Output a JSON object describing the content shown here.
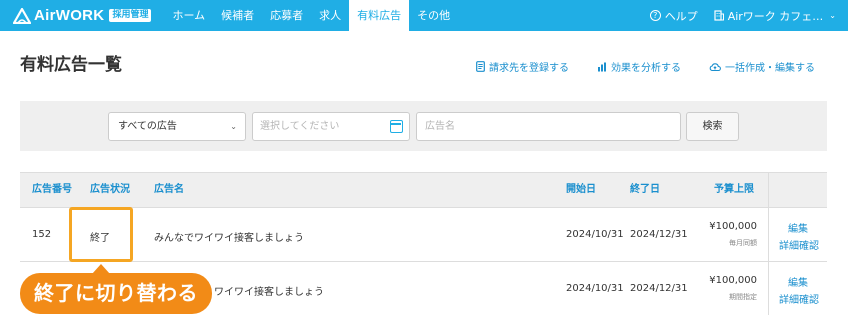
{
  "header": {
    "logo_text": "AirWORK",
    "logo_badge": "採用管理",
    "nav": [
      {
        "label": "ホーム",
        "active": false
      },
      {
        "label": "候補者",
        "active": false
      },
      {
        "label": "応募者",
        "active": false
      },
      {
        "label": "求人",
        "active": false
      },
      {
        "label": "有料広告",
        "active": true
      },
      {
        "label": "その他",
        "active": false
      }
    ],
    "help_label": "ヘルプ",
    "account_label": "Airワーク カフェ…"
  },
  "page": {
    "title": "有料広告一覧",
    "actions": [
      {
        "label": "請求先を登録する",
        "icon": "document-icon"
      },
      {
        "label": "効果を分析する",
        "icon": "bar-chart-icon"
      },
      {
        "label": "一括作成・編集する",
        "icon": "cloud-upload-icon"
      }
    ]
  },
  "search": {
    "type_select": "すべての広告",
    "date_placeholder": "選択してください",
    "name_placeholder": "広告名",
    "button_label": "検索"
  },
  "table": {
    "headers": {
      "number": "広告番号",
      "status": "広告状況",
      "name": "広告名",
      "start": "開始日",
      "end": "終了日",
      "budget": "予算上限"
    },
    "rows": [
      {
        "number": "152",
        "status": "終了",
        "name": "みんなでワイワイ接客しましょう",
        "start": "2024/10/31",
        "end": "2024/12/31",
        "budget": "¥100,000",
        "budget_type": "毎月同額",
        "edit": "編集",
        "detail": "詳細確認"
      },
      {
        "number": "",
        "status": "",
        "name": "ワイワイ接客しましょう",
        "start": "2024/10/31",
        "end": "2024/12/31",
        "budget": "¥100,000",
        "budget_type": "期間指定",
        "edit": "編集",
        "detail": "詳細確認"
      }
    ]
  },
  "callout": {
    "text": "終了に切り替わる"
  },
  "colors": {
    "brand": "#20aee5",
    "link": "#1a8fce",
    "accent": "#f28b17"
  }
}
